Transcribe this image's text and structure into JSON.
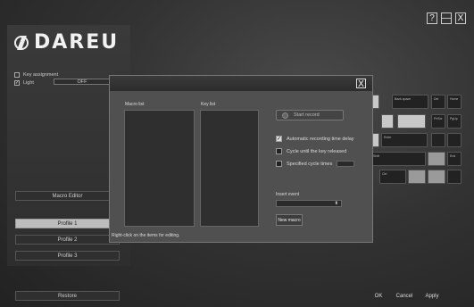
{
  "app": {
    "brand": "DAREU",
    "window_buttons": {
      "help": "?",
      "minimize": "—",
      "close": "X"
    }
  },
  "sidebar": {
    "key_assignment_label": "Key assignment",
    "light_label": "Light",
    "light_value": "OFF",
    "macro_editor": "Macro Editor",
    "profiles": [
      "Profile 1",
      "Profile 2",
      "Profile 3"
    ],
    "restore": "Restore"
  },
  "keyboard": {
    "keys": [
      "Back space",
      "Del",
      "Home",
      "Enter",
      "PrtScr",
      "PgUp",
      "Shift",
      "Ctrl",
      "End"
    ]
  },
  "footer": {
    "ok": "OK",
    "cancel": "Cancel",
    "apply": "Apply"
  },
  "macro_dialog": {
    "close": "X",
    "macro_list_label": "Macro list",
    "key_list_label": "Key list",
    "start_record": "Start record",
    "options": [
      {
        "label": "Automatic recording time delay",
        "checked": true
      },
      {
        "label": "Cycle until the key released",
        "checked": false
      },
      {
        "label": "Specified cycle times",
        "checked": false
      }
    ],
    "insert_event_label": "Insert event",
    "insert_event_value": "",
    "new_macro": "New macro",
    "hint": "Right-click on the items for editing."
  },
  "colors": {
    "accent": "#bdbdbd",
    "dialog_bg": "#505050",
    "app_bg": "#333333"
  }
}
